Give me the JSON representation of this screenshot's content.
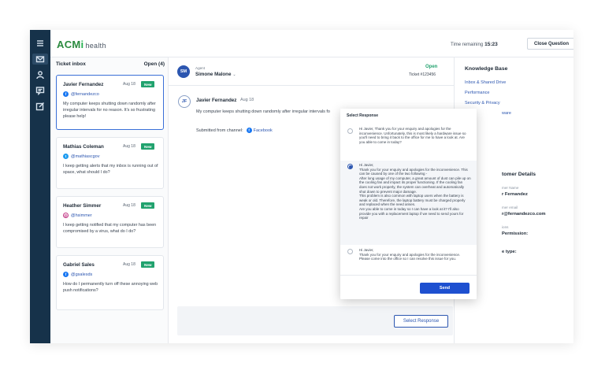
{
  "brand": {
    "logo_a": "ACM",
    "logo_m": "i",
    "logo_health": "health"
  },
  "header": {
    "timer_label": "Time remaining",
    "timer_value": "15:23",
    "close_question": "Close Question"
  },
  "rail": {
    "icons": [
      "menu-icon",
      "inbox-icon",
      "user-icon",
      "chat-icon",
      "edit-icon"
    ]
  },
  "inbox": {
    "title": "Ticket inbox",
    "open_count": "Open (4)",
    "tickets": [
      {
        "name": "Javier Fernandez",
        "date": "Aug 18",
        "badge": "New",
        "channel": "facebook",
        "handle": "@fernandezco",
        "message": "My computer keeps shutting down randomly after irregular intervals for no reason. It's so frustrating please help!"
      },
      {
        "name": "Mathias Coleman",
        "date": "Aug 18",
        "badge": "New",
        "channel": "twitter",
        "handle": "@mathiascgov",
        "message": "I keep getting alerts that my inbox is running out of space, what should I do?"
      },
      {
        "name": "Heather Simmer",
        "date": "Aug 18",
        "badge": "New",
        "channel": "instagram",
        "handle": "@hsimmer",
        "message": "I keep getting notified that my computer has been compromised by a virus, what do I do?"
      },
      {
        "name": "Gabriel Sales",
        "date": "Aug 18",
        "badge": "New",
        "channel": "facebook",
        "handle": "@gsalesds",
        "message": "How do I permanently turn off these annoying web push notifications?"
      }
    ]
  },
  "conversation": {
    "agent_label": "Agent",
    "agent_initials": "SM",
    "agent_name": "Simone Malone",
    "status": "Open",
    "ticket_number": "Ticket #123456",
    "customer_initials": "JF",
    "customer_name": "Javier Fernandez",
    "message_date": "Aug 18",
    "message_body": "My computer keeps shutting down randomly after irregular intervals fo",
    "submitted_from": "Submitted from channel:",
    "channel_name": "Facebook",
    "select_response": "Select Response"
  },
  "knowledge_base": {
    "title": "Knowledge Base",
    "links": [
      "Inbox & Shared Drive",
      "Performance",
      "Security & Privacy",
      "ware"
    ]
  },
  "customer_details": {
    "title": "tomer Details",
    "name_label": "mer Name",
    "name_value": "r Fernandez",
    "email_label": "mer email",
    "email_value": "r@fernandezco.com",
    "permission_label": "ions",
    "permission_value": "Permission:",
    "type_value": "e type:"
  },
  "modal": {
    "title": "Select Response",
    "options": [
      {
        "selected": false,
        "text": "Hi Javier, Thank you for your enquiry and apologies for the inconvenience. Unfortunately, this is most likely a hardware issue so you'll need to bring it back to the office for me to have a look at. Are you able to come in today?"
      },
      {
        "selected": true,
        "text": "Hi Javier,\nThank you for your enquiry and apologies for the inconvenience. This can be caused by one of the two following -\nAfter long usage of my computer, a great amount of dust can pile up on the cooling fan and impact its proper functioning. If the cooling fan does not work properly, the system can overheat and automatically shut down to prevent major damage.\nThis problem is also common with laptop users when the battery is weak or old. Therefore, the laptop battery must be charged properly and replaced when the need arises.\nAre you able to come in today so I can have a look at it? I'll also provide you with a replacement laptop if we need to send yours for repair"
      },
      {
        "selected": false,
        "text": "Hi Javier,\nThank you for your enquiry and apologies for the inconvenience. Please come into the office so I can resolve this issue for you."
      }
    ],
    "send_label": "Send"
  }
}
